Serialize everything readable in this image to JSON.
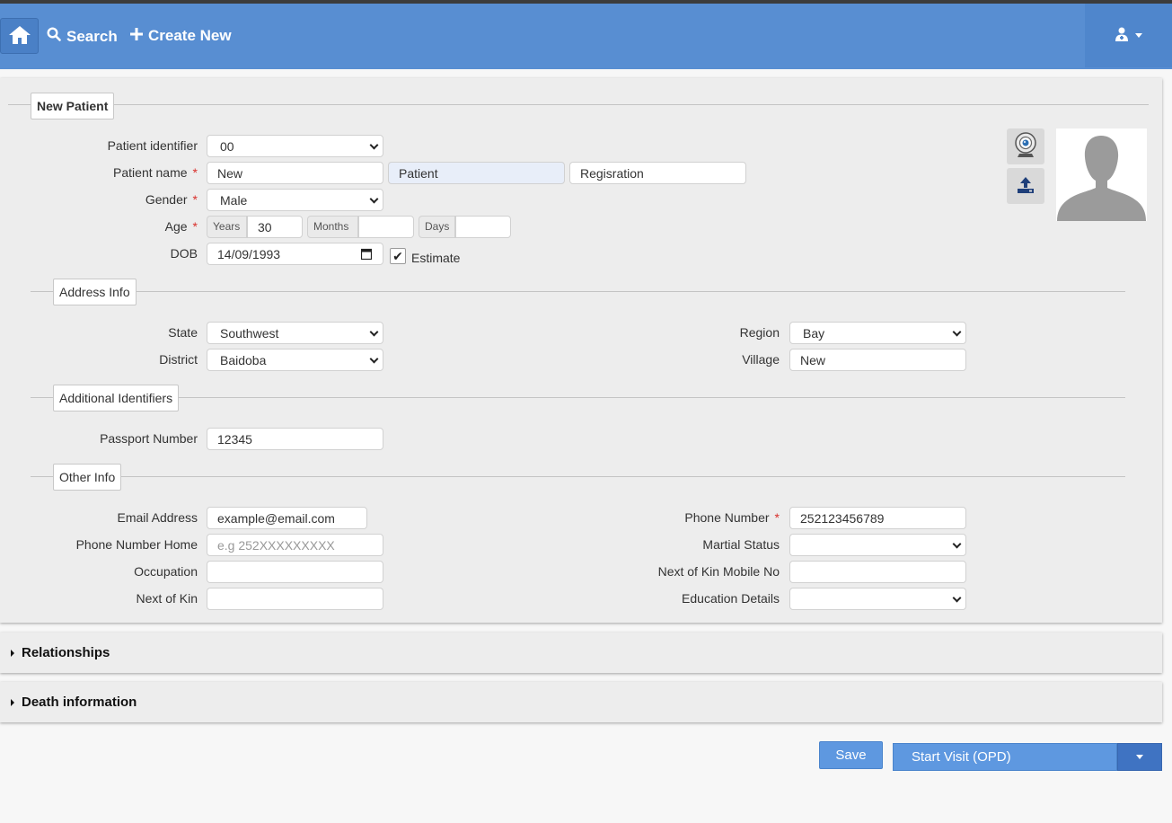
{
  "nav": {
    "search_label": "Search",
    "create_label": "Create New",
    "home_icon": "home-icon",
    "user_icon": "user-doctor-icon"
  },
  "form": {
    "legend": "New Patient",
    "patient_identifier": {
      "label": "Patient identifier",
      "value": "00"
    },
    "patient_name": {
      "label": "Patient name",
      "first": "New",
      "middle": "Patient",
      "last": "Regisration"
    },
    "gender": {
      "label": "Gender",
      "value": "Male"
    },
    "age": {
      "label": "Age",
      "years_label": "Years",
      "years": "30",
      "months_label": "Months",
      "months": "",
      "days_label": "Days",
      "days": ""
    },
    "dob": {
      "label": "DOB",
      "value": "14/09/1993",
      "estimate_label": "Estimate",
      "estimate_checked": "✔"
    },
    "required_mark": "*"
  },
  "address": {
    "legend": "Address Info",
    "state": {
      "label": "State",
      "value": "Southwest"
    },
    "district": {
      "label": "District",
      "value": "Baidoba"
    },
    "region": {
      "label": "Region",
      "value": "Bay"
    },
    "village": {
      "label": "Village",
      "value": "New"
    }
  },
  "identifiers": {
    "legend": "Additional Identifiers",
    "passport": {
      "label": "Passport Number",
      "value": "12345"
    }
  },
  "other": {
    "legend": "Other Info",
    "email": {
      "label": "Email Address",
      "value": "example@email.com"
    },
    "phone_home": {
      "label": "Phone Number Home",
      "placeholder": "e.g 252XXXXXXXXX"
    },
    "occupation": {
      "label": "Occupation",
      "value": ""
    },
    "next_of_kin": {
      "label": "Next of Kin",
      "value": ""
    },
    "phone": {
      "label": "Phone Number",
      "value": "252123456789"
    },
    "marital": {
      "label": "Martial Status",
      "value": ""
    },
    "kin_mobile": {
      "label": "Next of Kin Mobile No",
      "value": ""
    },
    "education": {
      "label": "Education Details",
      "value": ""
    }
  },
  "sections": {
    "relationships": "Relationships",
    "death": "Death information"
  },
  "actions": {
    "save": "Save",
    "start_visit": "Start Visit (OPD)"
  }
}
